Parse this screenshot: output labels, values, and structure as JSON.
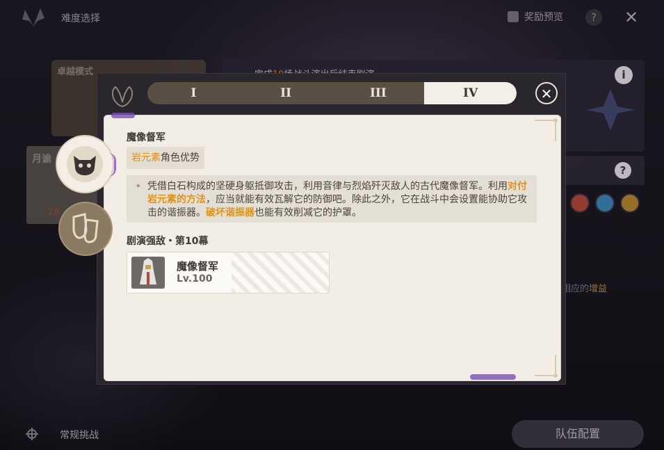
{
  "window": {
    "title": "难度选择"
  },
  "header": {
    "reward_preview": "奖励预览",
    "help": "?",
    "close": "✕"
  },
  "background": {
    "mode_card_title": "卓越模式",
    "moon_card_title": "月谕",
    "moon_card_value": "28",
    "mission_prefix": "完成",
    "mission_number": "10",
    "mission_suffix": "场战斗演出后结束剧演",
    "info": "i",
    "help2": "?",
    "side_note_text": "相应的",
    "side_note_highlight": "增益",
    "normal_challenge_label": "常规挑战",
    "team_config_label": "队伍配置",
    "element_icons": [
      "pyro-icon",
      "cryo-icon",
      "geo-icon"
    ]
  },
  "modal": {
    "tabs": [
      {
        "label": "I",
        "active": false
      },
      {
        "label": "II",
        "active": false
      },
      {
        "label": "III",
        "active": false
      },
      {
        "label": "IV",
        "active": true
      }
    ],
    "close": "✕",
    "boss_name": "魔像督军",
    "advantage_highlight": "岩元素",
    "advantage_rest": "角色优势",
    "description": {
      "part1": "凭借白石构成的坚硬身躯抵御攻击，利用音律与烈焰歼灭敌人的古代魔像督军。利用",
      "hl1": "对付岩元素的方法",
      "part2": "，应当就能有效瓦解它的防御吧。除此之外，它在战斗中会设置能协助它攻击的谐振器。",
      "hl2": "破坏谐振器",
      "part3": "也能有效削减它的护罩。"
    },
    "section_title": "剧演强敌・第10幕",
    "enemy": {
      "name": "魔像督军",
      "level": "Lv.100"
    }
  },
  "colors": {
    "highlight": "#e09318",
    "panel": "#f2eee6",
    "tab_bar": "#5a4f45",
    "accent_purple": "#7b4fb5"
  }
}
